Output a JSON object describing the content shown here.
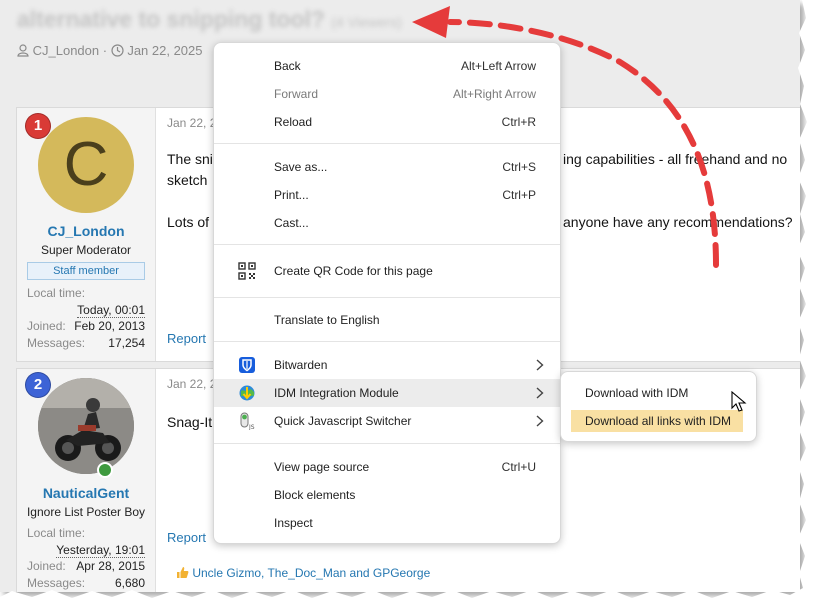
{
  "thread": {
    "title": "alternative to snipping tool?",
    "views": "(4 Viewers)",
    "author": "CJ_London",
    "date": "Jan 22, 2025"
  },
  "posts": [
    {
      "number": "1",
      "avatar_letter": "C",
      "username": "CJ_London",
      "user_title": "Super Moderator",
      "staff_badge": "Staff member",
      "local_time_label": "Local time:",
      "local_time": "Today, 00:01",
      "joined_label": "Joined:",
      "joined": "Feb 20, 2013",
      "messages_label": "Messages:",
      "messages": "17,254",
      "date": "Jan 22, 2",
      "text_line1_start": "The sni",
      "text_line1_end": "ing capabilities - all freehand and no",
      "text_line2": "sketch",
      "text_line3_start": "Lots of",
      "text_line3_end": "anyone have any recommendations?",
      "report": "Report"
    },
    {
      "number": "2",
      "username": "NauticalGent",
      "user_title": "Ignore List Poster Boy",
      "local_time_label": "Local time:",
      "local_time": "Yesterday, 19:01",
      "joined_label": "Joined:",
      "joined": "Apr 28, 2015",
      "messages_label": "Messages:",
      "messages": "6,680",
      "date": "Jan 22, 2",
      "text_line1_start": "Snag-It",
      "report": "Report",
      "likes": "Uncle Gizmo, The_Doc_Man and GPGeorge"
    }
  ],
  "context_menu": {
    "items": [
      {
        "label": "Back",
        "shortcut": "Alt+Left Arrow"
      },
      {
        "label": "Forward",
        "shortcut": "Alt+Right Arrow"
      },
      {
        "label": "Reload",
        "shortcut": "Ctrl+R"
      },
      {
        "label": "Save as...",
        "shortcut": "Ctrl+S"
      },
      {
        "label": "Print...",
        "shortcut": "Ctrl+P"
      },
      {
        "label": "Cast..."
      },
      {
        "label": "Create QR Code for this page",
        "icon": "qr-code-icon"
      },
      {
        "label": "Translate to English"
      },
      {
        "label": "Bitwarden",
        "icon": "bitwarden-icon"
      },
      {
        "label": "IDM Integration Module",
        "icon": "idm-icon"
      },
      {
        "label": "Quick Javascript Switcher",
        "icon": "javascript-switcher-icon"
      },
      {
        "label": "View page source",
        "shortcut": "Ctrl+U"
      },
      {
        "label": "Block elements"
      },
      {
        "label": "Inspect"
      }
    ]
  },
  "submenu": {
    "items": [
      {
        "label": "Download with IDM"
      },
      {
        "label": "Download all links with IDM"
      }
    ]
  },
  "colors": {
    "accent_link": "#2577b1",
    "annotation_arrow": "#e53b3b",
    "highlight": "#f9e0a3"
  }
}
